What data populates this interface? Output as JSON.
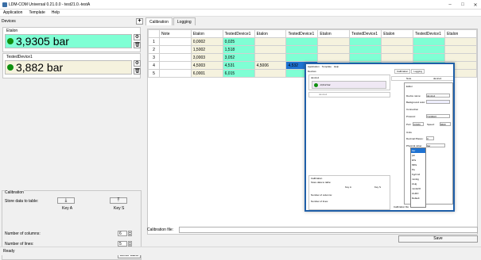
{
  "window": {
    "title": "LDM-COM Universal 0.21.0.0 - test21.0.-testA"
  },
  "menu": [
    "Application",
    "Template",
    "Help"
  ],
  "devices": {
    "header": "Devices",
    "items": [
      {
        "name": "Etalon",
        "value": "3,9305 bar",
        "bg": "#7fffd4"
      },
      {
        "name": "TestedDevice1",
        "value": "3,882 bar",
        "bg": "#f5f2de"
      }
    ]
  },
  "calibration": {
    "title": "Calibration",
    "store_label": "Store data to table:",
    "key_a": "Key A",
    "key_s": "Key S",
    "columns_label": "Number of columns:",
    "columns_value": "6",
    "lines_label": "Number of lines:",
    "lines_value": "5",
    "clear_label": "Clear table"
  },
  "tabs": [
    "Calibration",
    "Logging"
  ],
  "table": {
    "headers": [
      "Note",
      "Etalon",
      "TestedDevice1",
      "Etalon",
      "TestedDevice1",
      "Etalon",
      "TestedDevice1",
      "Etalon",
      "TestedDevice1",
      "Etalon"
    ],
    "rows": [
      [
        "",
        "0,0002",
        "0,025",
        "",
        "",
        "",
        "",
        "",
        "",
        ""
      ],
      [
        "",
        "1,5002",
        "1,518",
        "",
        "",
        "",
        "",
        "",
        "",
        ""
      ],
      [
        "",
        "3,0003",
        "3,052",
        "",
        "",
        "",
        "",
        "",
        "",
        ""
      ],
      [
        "",
        "4,5003",
        "4,531",
        "4,5006",
        "4,532",
        "",
        "",
        "",
        "",
        ""
      ],
      [
        "",
        "6,0001",
        "6,015",
        "",
        "",
        "",
        "",
        "",
        "",
        ""
      ]
    ]
  },
  "calfile_label": "Calibration file:",
  "save_label": "Save",
  "status": "Ready",
  "overlay": {
    "menu": [
      "Application",
      "Template",
      "Help"
    ],
    "devices": "Devices",
    "dev1": "device1",
    "value": "-0,012 bar",
    "dev2": "device2",
    "calib": "Calibration",
    "store": "Store data to table:",
    "key_a": "Key A",
    "key_s": "Key S",
    "cols": "Number of columns:",
    "lines": "Number of lines:",
    "tabs": [
      "Calibration",
      "Logging"
    ],
    "grid_note": "Note",
    "grid_dev": "device1",
    "calfile": "Calibration file:",
    "dlg": {
      "editor": "Editor",
      "device_name": "Device name:",
      "device_name_val": "device1",
      "bg_color": "Background color:",
      "connection": "Connection",
      "protocol": "Protocol:",
      "protocol_val": "TLDMAX",
      "port": "Port:",
      "port_val": "COM3",
      "speed": "Speed:",
      "speed_val": "9600",
      "units": "Units",
      "decimal": "Decimal Places:",
      "decimal_val": "3",
      "phys": "Physical value:",
      "phys_val": "bar"
    },
    "units": [
      "bar",
      "psi",
      "kPa",
      "MPa",
      "Pa",
      "Kg/cm2",
      "mmHg",
      "inHg",
      "mmH2O",
      "inH2O",
      "Default"
    ]
  }
}
